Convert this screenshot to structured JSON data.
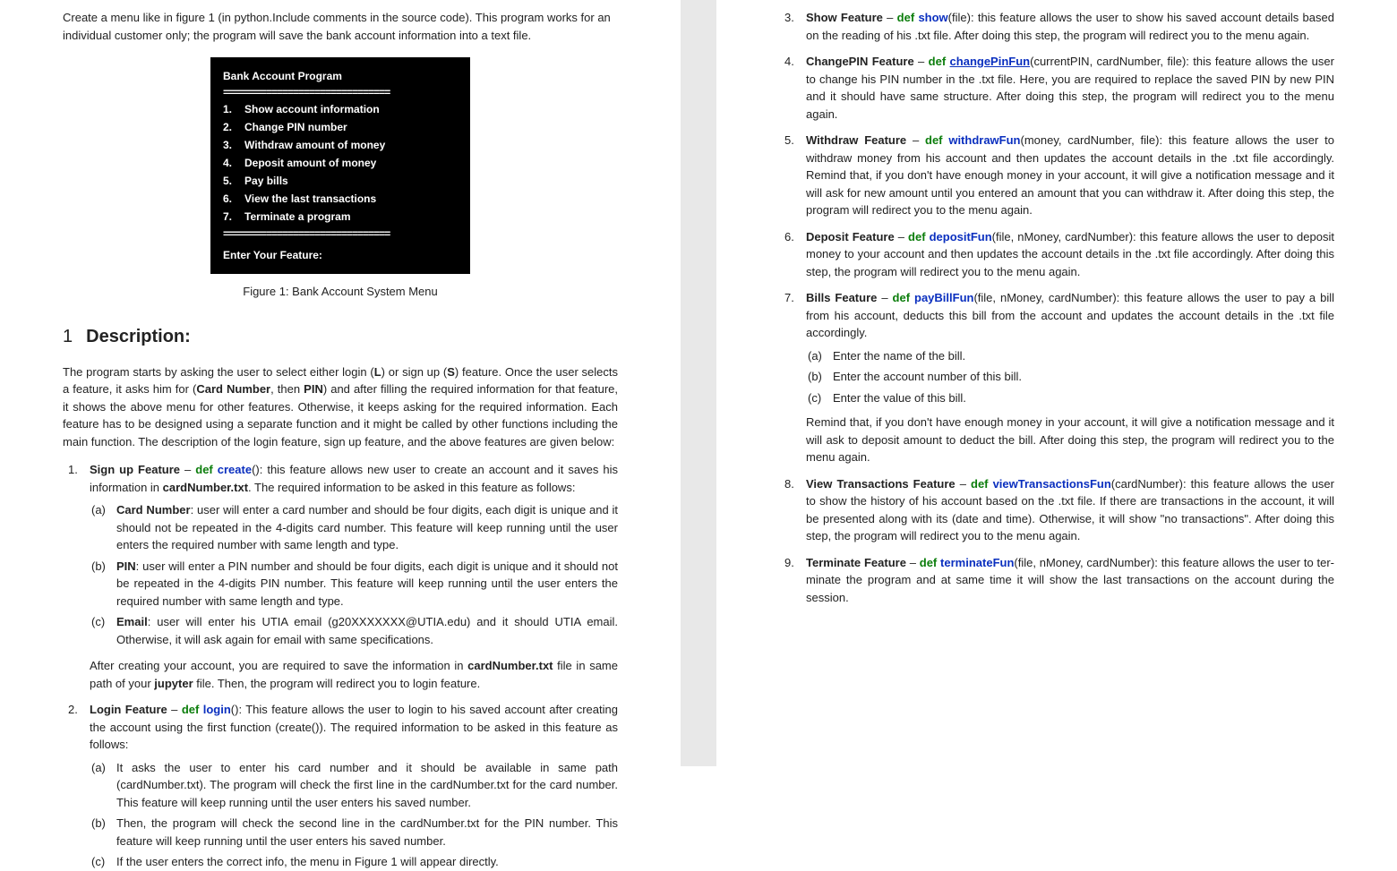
{
  "intro": "Create a menu like in figure 1 (in python.Include comments in the source code). This program works for an individual customer only; the program will save the bank account information into a text file.",
  "figure": {
    "title": "Bank Account Program",
    "sep": "===============================",
    "items": [
      {
        "n": "1.",
        "label": "Show account information"
      },
      {
        "n": "2.",
        "label": "Change PIN number"
      },
      {
        "n": "3.",
        "label": "Withdraw amount of money"
      },
      {
        "n": "4.",
        "label": "Deposit amount of money"
      },
      {
        "n": "5.",
        "label": "Pay bills"
      },
      {
        "n": "6.",
        "label": "View the last transactions"
      },
      {
        "n": "7.",
        "label": "Terminate a program"
      }
    ],
    "prompt": "Enter Your Feature:",
    "caption": "Figure 1: Bank Account System Menu"
  },
  "section_num": "1",
  "section_title": "Description:",
  "desc_p1a": "The program starts by asking the user to select either login (",
  "desc_p1_L": "L",
  "desc_p1b": ") or sign up (",
  "desc_p1_S": "S",
  "desc_p1c": ") feature. Once the user selects a feature, it asks him for (",
  "desc_p1_card": "Card Number",
  "desc_p1d": ", then ",
  "desc_p1_pin": "PIN",
  "desc_p1e": ") and after filling the required information for that feature, it shows the above menu for other features. Otherwise, it keeps asking for the required information. Each feature has to be designed using a separate function and it might be called by other functions including the main function. The description of the login feature, sign up feature, and the above features are given below:",
  "f1": {
    "num": "1.",
    "title": "Sign up Feature",
    "dash": " – ",
    "def": "def ",
    "fn": "create",
    "tail_a": "(): this feature allows new user to create an account and it saves his information in ",
    "tail_file": "cardNumber.txt",
    "tail_b": ". The required information to be asked in this feature as follows:",
    "sub": [
      {
        "n": "(a)",
        "t_a": "Card Number",
        "t_b": ": user will enter a card number and should be four digits, each digit is unique and it should not be repeated in the 4-digits card number. This feature will keep running until the user enters the required number with same length and type."
      },
      {
        "n": "(b)",
        "t_a": "PIN",
        "t_b": ": user will enter a PIN number and should be four digits, each digit is unique and it should not be repeated in the 4-digits PIN number. This feature will keep running until the user enters the required number with same length and type."
      },
      {
        "n": "(c)",
        "t_a": "Email",
        "t_b": ": user will enter his UTIA email (g20XXXXXXX@UTIA.edu) and it should UTIA email. Otherwise, it will ask again for email with same specifications."
      }
    ],
    "after_a": "After creating your account, you are required to save the information in ",
    "after_file": "cardNumber.txt",
    "after_b": " file in same path of your ",
    "after_jup": "jupyter",
    "after_c": " file. Then, the program will redirect you to login feature."
  },
  "f2": {
    "num": "2.",
    "title": "Login Feature",
    "dash": " – ",
    "def": "def ",
    "fn": "login",
    "tail": "(): This feature allows the user to login to his saved account after creating the account using the first function (create()). The required information to be asked in this feature as follows:",
    "sub": [
      {
        "n": "(a)",
        "t": "It asks the user to enter his card number and it should be available in same path (cardNumber.txt). The program will check the first line in the cardNumber.txt for the card number. This feature will keep running until the user enters his saved number."
      },
      {
        "n": "(b)",
        "t": "Then, the program will check the second line in the cardNumber.txt for the PIN number. This feature will keep running until the user enters his saved number."
      },
      {
        "n": "(c)",
        "t": "If the user enters the correct info, the menu in Figure 1 will appear directly."
      }
    ]
  },
  "f3": {
    "num": "3.",
    "title": "Show Feature",
    "dash": " – ",
    "def": "def ",
    "fn": "show",
    "tail": "(file): this feature allows the user to show his saved account details based on the reading of his .txt file. After doing this step, the program will redirect you to the menu again."
  },
  "f4": {
    "num": "4.",
    "title": "ChangePIN Feature",
    "dash": " – ",
    "def": "def ",
    "fn": "changePinFun",
    "tail": "(currentPIN, cardNumber, file): this feature allows the user to change his PIN number in the .txt file. Here, you are required to replace the saved PIN by new PIN and it should have same structure. After doing this step, the program will redirect you to the menu again."
  },
  "f5": {
    "num": "5.",
    "title": "Withdraw Feature",
    "dash": " – ",
    "def": "def ",
    "fn": "withdrawFun",
    "tail": "(money, cardNumber, file): this feature allows the user to withdraw money from his account and then updates the account details in the .txt file accordingly. Remind that, if you don't have enough money in your account, it will give a notification message and it will ask for new amount until you entered an amount that you can withdraw it. After doing this step, the program will redirect you to the menu again."
  },
  "f6": {
    "num": "6.",
    "title": "Deposit Feature",
    "dash": " – ",
    "def": "def ",
    "fn": "depositFun",
    "tail": "(file, nMoney, cardNumber): this feature allows the user to deposit money to your account and then updates the account details in the .txt file accordingly. After doing this step, the program will redirect you to the menu again."
  },
  "f7": {
    "num": "7.",
    "title": "Bills Feature",
    "dash": " – ",
    "def": "def ",
    "fn": "payBillFun",
    "tail": "(file, nMoney, cardNumber): this feature allows the user to pay a bill from his account, deducts this bill from the account and updates the account details in the .txt file accordingly.",
    "sub": [
      {
        "n": "(a)",
        "t": "Enter the name of the bill."
      },
      {
        "n": "(b)",
        "t": "Enter the account number of this bill."
      },
      {
        "n": "(c)",
        "t": "Enter the value of this bill."
      }
    ],
    "remind": "Remind that, if you don't have enough money in your account, it will give a notification message and it will ask to deposit amount to deduct the bill. After doing this step, the program will redirect you to the menu again."
  },
  "f8": {
    "num": "8.",
    "title": "View Transactions Feature",
    "dash": " – ",
    "def": "def ",
    "fn": "viewTransactionsFun",
    "tail": "(cardNumber): this feature allows the user to show the history of his account based on the .txt file. If there are transactions in the account, it will be presented along with its (date and time). Otherwise, it will show \"no transactions\". After doing this step, the program will redirect you to the menu again."
  },
  "f9": {
    "num": "9.",
    "title": "Terminate Feature",
    "dash": " – ",
    "def": "def ",
    "fn": "terminateFun",
    "tail": "(file, nMoney, cardNumber): this feature allows the user to ter-minate the program and at same time it will show the last transactions on the account during the session."
  }
}
